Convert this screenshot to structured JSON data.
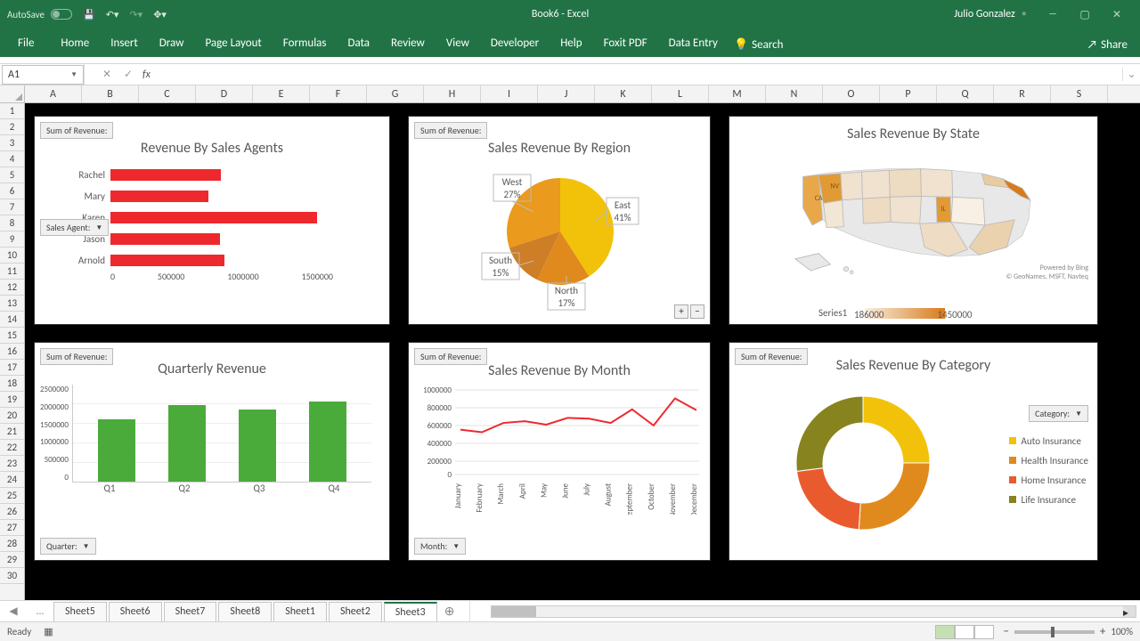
{
  "titlebar": {
    "autosave": "AutoSave",
    "title": "Book6 - Excel",
    "user": "Julio Gonzalez"
  },
  "ribbon": {
    "tabs": [
      "File",
      "Home",
      "Insert",
      "Draw",
      "Page Layout",
      "Formulas",
      "Data",
      "Review",
      "View",
      "Developer",
      "Help",
      "Foxit PDF",
      "Data Entry"
    ],
    "search": "Search",
    "share": "Share"
  },
  "namebox": "A1",
  "columns": [
    "A",
    "B",
    "C",
    "D",
    "E",
    "F",
    "G",
    "H",
    "I",
    "J",
    "K",
    "L",
    "M",
    "N",
    "O",
    "P",
    "Q",
    "R",
    "S"
  ],
  "rowcount": 30,
  "dashboard": {
    "c1": {
      "sum_label": "Sum of Revenue:",
      "slicer": "Sales Agent:",
      "title": "Revenue By Sales Agents"
    },
    "c2": {
      "sum_label": "Sum of Revenue:",
      "title": "Sales Revenue By Region"
    },
    "c3": {
      "title": "Sales Revenue By State",
      "legend": "Series1",
      "min": "186000",
      "max": "1450000",
      "credit1": "Powered by Bing",
      "credit2": "© GeoNames, MSFT, Navteq"
    },
    "c4": {
      "sum_label": "Sum of Revenue:",
      "title": "Quarterly Revenue",
      "slicer": "Quarter:"
    },
    "c5": {
      "sum_label": "Sum of Revenue:",
      "title": "Sales Revenue By Month",
      "slicer": "Month:"
    },
    "c6": {
      "sum_label": "Sum of Revenue:",
      "title": "Sales Revenue By Category",
      "slicer": "Category:",
      "legend": [
        "Auto Insurance",
        "Health Insurance",
        "Home Insurance",
        "Life Insurance"
      ]
    }
  },
  "chart_data": [
    {
      "type": "bar",
      "orientation": "horizontal",
      "title": "Revenue By Sales Agents",
      "categories": [
        "Rachel",
        "Mary",
        "Karen",
        "Jason",
        "Arnold"
      ],
      "values": [
        745000,
        660000,
        1390000,
        740000,
        770000
      ],
      "xmax": 1500000,
      "xticks": [
        "0",
        "500000",
        "1000000",
        "1500000"
      ]
    },
    {
      "type": "pie",
      "title": "Sales Revenue By Region",
      "categories": [
        "East",
        "North",
        "South",
        "West"
      ],
      "values": [
        41,
        17,
        15,
        27
      ],
      "colors": [
        "#f2c20a",
        "#e08a1e",
        "#cf7e28",
        "#ea9a1c"
      ]
    },
    {
      "type": "heatmap",
      "title": "Sales Revenue By State",
      "range": [
        186000,
        1450000
      ],
      "highlighted": [
        "CA",
        "NV",
        "IL"
      ]
    },
    {
      "type": "bar",
      "title": "Quarterly Revenue",
      "categories": [
        "Q1",
        "Q2",
        "Q3",
        "Q4"
      ],
      "values": [
        1600000,
        1950000,
        1850000,
        2050000
      ],
      "ymax": 2500000,
      "yticks": [
        "500000",
        "1000000",
        "1500000",
        "2000000",
        "2500000"
      ]
    },
    {
      "type": "line",
      "title": "Sales Revenue By Month",
      "categories": [
        "January",
        "February",
        "March",
        "April",
        "May",
        "June",
        "July",
        "August",
        "September",
        "October",
        "November",
        "December"
      ],
      "values": [
        530000,
        500000,
        610000,
        630000,
        590000,
        670000,
        660000,
        610000,
        770000,
        580000,
        900000,
        760000
      ],
      "ymax": 1000000,
      "yticks": [
        "200000",
        "400000",
        "600000",
        "800000",
        "1000000"
      ]
    },
    {
      "type": "pie",
      "subtype": "doughnut",
      "title": "Sales Revenue By Category",
      "categories": [
        "Auto Insurance",
        "Health Insurance",
        "Home Insurance",
        "Life Insurance"
      ],
      "values": [
        25,
        26,
        22,
        27
      ],
      "colors": [
        "#f2c20a",
        "#e08a1e",
        "#e95b2e",
        "#87841f"
      ]
    }
  ],
  "sheettabs": {
    "visible": [
      "Sheet5",
      "Sheet6",
      "Sheet7",
      "Sheet8",
      "Sheet1",
      "Sheet2",
      "Sheet3"
    ],
    "active": "Sheet3",
    "overflow": "..."
  },
  "statusbar": {
    "ready": "Ready",
    "zoom": "100%"
  }
}
